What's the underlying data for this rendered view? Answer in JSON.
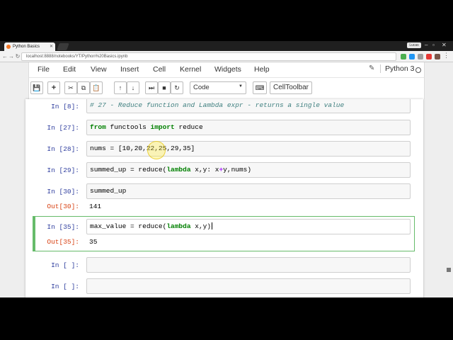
{
  "browser": {
    "tab_title": "Python Basics",
    "url": "localhost:8888/notebooks/YT/Python%20Basics.ipynb",
    "user_label": "Lucas"
  },
  "menubar": {
    "items": [
      "File",
      "Edit",
      "View",
      "Insert",
      "Cell",
      "Kernel",
      "Widgets",
      "Help"
    ],
    "kernel_name": "Python 3"
  },
  "toolbar": {
    "cell_type": "Code",
    "celltoolbar_label": "CellToolbar"
  },
  "cells": {
    "c1": {
      "prompt": "In [8]:",
      "code": "# 27 - Reduce function and Lambda expr - returns a single value"
    },
    "c2": {
      "prompt": "In [27]:",
      "kw1": "from",
      "mid": " functools ",
      "kw2": "import",
      "tail": " reduce"
    },
    "c3": {
      "prompt": "In [28]:",
      "code": "nums = [10,20,22,25,29,35]"
    },
    "c4": {
      "prompt": "In [29]:",
      "pre": "summed_up = reduce(",
      "kw": "lambda",
      "post": " x,y: x",
      "op": "+",
      "end": "y,nums)"
    },
    "c5": {
      "prompt": "In [30]:",
      "code": "summed_up",
      "out_prompt": "Out[30]:",
      "out": "141"
    },
    "c6": {
      "prompt": "In [35]:",
      "pre": "max_value = reduce(",
      "kw": "lambda",
      "post": " x,y)",
      "out_prompt": "Out[35]:",
      "out": "35"
    },
    "c7": {
      "prompt": "In [ ]:"
    },
    "c8": {
      "prompt": "In [ ]:"
    }
  },
  "colors": {
    "in_prompt": "#303f9f",
    "out_prompt": "#d84315",
    "edit_border": "#66bb6a",
    "keyword": "#008000",
    "comment": "#408080"
  }
}
